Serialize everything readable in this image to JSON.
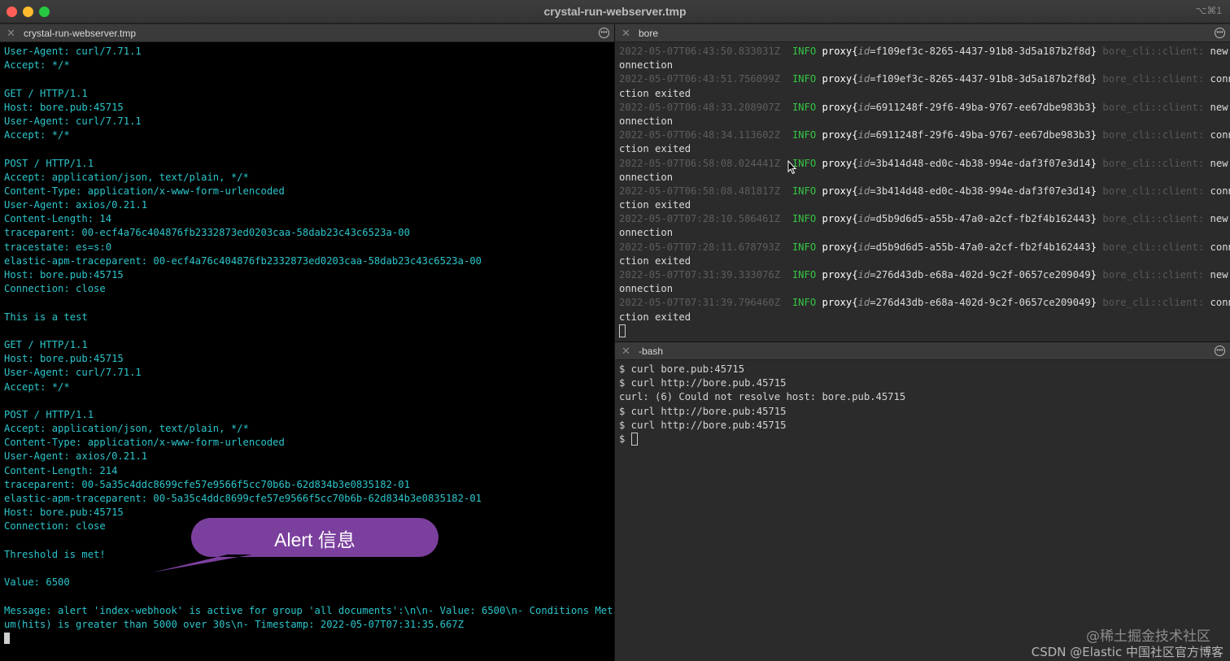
{
  "window": {
    "title": "crystal-run-webserver.tmp",
    "shortcut": "⌥⌘1"
  },
  "left_pane": {
    "tab_title": "crystal-run-webserver.tmp",
    "lines": [
      "User-Agent: curl/7.71.1",
      "Accept: */*",
      "",
      "GET / HTTP/1.1",
      "Host: bore.pub:45715",
      "User-Agent: curl/7.71.1",
      "Accept: */*",
      "",
      "POST / HTTP/1.1",
      "Accept: application/json, text/plain, */*",
      "Content-Type: application/x-www-form-urlencoded",
      "User-Agent: axios/0.21.1",
      "Content-Length: 14",
      "traceparent: 00-ecf4a76c404876fb2332873ed0203caa-58dab23c43c6523a-00",
      "tracestate: es=s:0",
      "elastic-apm-traceparent: 00-ecf4a76c404876fb2332873ed0203caa-58dab23c43c6523a-00",
      "Host: bore.pub:45715",
      "Connection: close",
      "",
      "This is a test",
      "",
      "GET / HTTP/1.1",
      "Host: bore.pub:45715",
      "User-Agent: curl/7.71.1",
      "Accept: */*",
      "",
      "POST / HTTP/1.1",
      "Accept: application/json, text/plain, */*",
      "Content-Type: application/x-www-form-urlencoded",
      "User-Agent: axios/0.21.1",
      "Content-Length: 214",
      "traceparent: 00-5a35c4ddc8699cfe57e9566f5cc70b6b-62d834b3e0835182-01",
      "elastic-apm-traceparent: 00-5a35c4ddc8699cfe57e9566f5cc70b6b-62d834b3e0835182-01",
      "Host: bore.pub:45715",
      "Connection: close",
      "",
      "Threshold is met!",
      "",
      "Value: 6500",
      "",
      "Message: alert 'index-webhook' is active for group 'all documents':\\n\\n- Value: 6500\\n- Conditions Met: s",
      "um(hits) is greater than 5000 over 30s\\n- Timestamp: 2022-05-07T07:31:35.667Z",
      ""
    ]
  },
  "bore_pane": {
    "tab_title": "bore",
    "entries": [
      {
        "ts": "2022-05-07T06:43:50.833031Z",
        "level": "INFO",
        "span": "proxy",
        "field": "id",
        "id": "f109ef3c-8265-4437-91b8-3d5a187b2f8d",
        "target": "bore_cli::client",
        "msg1": "new c",
        "msg2": "onnection"
      },
      {
        "ts": "2022-05-07T06:43:51.756099Z",
        "level": "INFO",
        "span": "proxy",
        "field": "id",
        "id": "f109ef3c-8265-4437-91b8-3d5a187b2f8d",
        "target": "bore_cli::client",
        "msg1": "conne",
        "msg2": "ction exited"
      },
      {
        "ts": "2022-05-07T06:48:33.208907Z",
        "level": "INFO",
        "span": "proxy",
        "field": "id",
        "id": "6911248f-29f6-49ba-9767-ee67dbe983b3",
        "target": "bore_cli::client",
        "msg1": "new c",
        "msg2": "onnection"
      },
      {
        "ts": "2022-05-07T06:48:34.113602Z",
        "level": "INFO",
        "span": "proxy",
        "field": "id",
        "id": "6911248f-29f6-49ba-9767-ee67dbe983b3",
        "target": "bore_cli::client",
        "msg1": "conne",
        "msg2": "ction exited"
      },
      {
        "ts": "2022-05-07T06:58:08.024441Z",
        "level": "INFO",
        "span": "proxy",
        "field": "id",
        "id": "3b414d48-ed0c-4b38-994e-daf3f07e3d14",
        "target": "bore_cli::client",
        "msg1": "new c",
        "msg2": "onnection"
      },
      {
        "ts": "2022-05-07T06:58:08.481817Z",
        "level": "INFO",
        "span": "proxy",
        "field": "id",
        "id": "3b414d48-ed0c-4b38-994e-daf3f07e3d14",
        "target": "bore_cli::client",
        "msg1": "conne",
        "msg2": "ction exited"
      },
      {
        "ts": "2022-05-07T07:28:10.586461Z",
        "level": "INFO",
        "span": "proxy",
        "field": "id",
        "id": "d5b9d6d5-a55b-47a0-a2cf-fb2f4b162443",
        "target": "bore_cli::client",
        "msg1": "new c",
        "msg2": "onnection"
      },
      {
        "ts": "2022-05-07T07:28:11.678793Z",
        "level": "INFO",
        "span": "proxy",
        "field": "id",
        "id": "d5b9d6d5-a55b-47a0-a2cf-fb2f4b162443",
        "target": "bore_cli::client",
        "msg1": "conne",
        "msg2": "ction exited"
      },
      {
        "ts": "2022-05-07T07:31:39.333076Z",
        "level": "INFO",
        "span": "proxy",
        "field": "id",
        "id": "276d43db-e68a-402d-9c2f-0657ce209049",
        "target": "bore_cli::client",
        "msg1": "new c",
        "msg2": "onnection"
      },
      {
        "ts": "2022-05-07T07:31:39.796460Z",
        "level": "INFO",
        "span": "proxy",
        "field": "id",
        "id": "276d43db-e68a-402d-9c2f-0657ce209049",
        "target": "bore_cli::client",
        "msg1": "conne",
        "msg2": "ction exited"
      }
    ]
  },
  "bash_pane": {
    "tab_title": "-bash",
    "lines": [
      "$ curl bore.pub:45715",
      "$ curl http://bore.pub.45715",
      "curl: (6) Could not resolve host: bore.pub.45715",
      "$ curl http://bore.pub:45715",
      "$ curl http://bore.pub:45715"
    ],
    "prompt": "$ "
  },
  "callout": {
    "text": "Alert 信息",
    "color": "#7b3f9e"
  },
  "watermarks": {
    "line1": "@稀土掘金技术社区",
    "line2": "CSDN @Elastic 中国社区官方博客"
  },
  "icons": [
    "close-icon",
    "tab-close-icon",
    "tab-menu-icon",
    "mouse-pointer-icon"
  ]
}
